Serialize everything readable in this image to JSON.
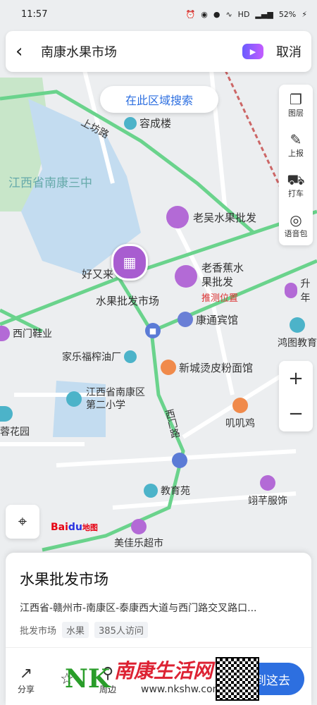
{
  "status": {
    "time": "11:57",
    "network": "HD",
    "battery": "52%"
  },
  "search": {
    "query": "南康水果市场",
    "cancel": "取消"
  },
  "area_search": "在此区域搜索",
  "tools": [
    {
      "icon": "layers-icon",
      "label": "图层"
    },
    {
      "icon": "report-icon",
      "label": "上报"
    },
    {
      "icon": "taxi-icon",
      "label": "打车"
    },
    {
      "icon": "voice-pack-icon",
      "label": "语音包"
    }
  ],
  "zoom": {
    "in": "+",
    "out": "−"
  },
  "map_labels": {
    "road_shangfang": "上坊路",
    "rongcheng": "容成楼",
    "school3": "江西省南康三中",
    "laowu": "老吴水果批发",
    "laoxiangjiao": "老香蕉水果批发",
    "tuice": "推测位置",
    "haoyoulai": "好又来",
    "market": "水果批发市场",
    "shengnian": "升年",
    "ximen_shoes": "西门鞋业",
    "kangtong": "康通宾馆",
    "hongtu": "鸿图教育",
    "jiale": "家乐福榨油厂",
    "xincheng": "新城烫皮粉面馆",
    "school2": "江西省南康区第二小学",
    "ximen_road": "西门路",
    "jiji": "叽叽鸡",
    "ronghuayuan": "蓉花园",
    "jiaoyu": "教育苑",
    "yixin": "翊芊服饰",
    "meijiale": "美佳乐超市"
  },
  "logo": {
    "bai": "Bai",
    "du": "du",
    "tu": "地图"
  },
  "card": {
    "title": "水果批发市场",
    "address": "江西省-赣州市-南康区-泰康西大道与西门路交叉路口...",
    "category": "批发市场",
    "tags": [
      "水果",
      "385人访问"
    ]
  },
  "actions": [
    {
      "icon": "share-icon",
      "label": "分享"
    },
    {
      "icon": "favorite-icon",
      "label": ""
    },
    {
      "icon": "nearby-icon",
      "label": "周边"
    }
  ],
  "route_button": "到这去",
  "watermark": {
    "nk": "NK",
    "site": "南康生活网",
    "url": "www.nkshw.com"
  },
  "colors": {
    "road_green": "#6ad38c",
    "accent": "#2d6fe0",
    "poi_purple": "#b36ad6",
    "water": "#c3dcf0"
  }
}
